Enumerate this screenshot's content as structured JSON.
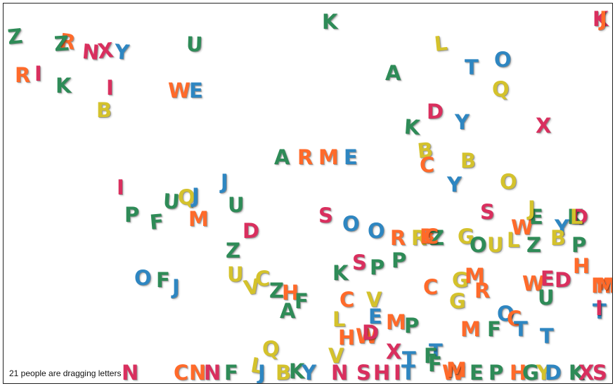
{
  "status_text": "21 people are dragging letters",
  "palette": {
    "G": "#2e8b57",
    "R": "#ff6a2a",
    "P": "#d92f5e",
    "B": "#2e86c1",
    "Y": "#d4c22c"
  },
  "letters": [
    [
      "Z",
      "G"
    ],
    [
      "R",
      "R"
    ],
    [
      "Z",
      "G"
    ],
    [
      "N",
      "P"
    ],
    [
      "X",
      "P"
    ],
    [
      "Y",
      "B"
    ],
    [
      "U",
      "G"
    ],
    [
      "K",
      "G"
    ],
    [
      "K",
      "P"
    ],
    [
      "J",
      "R"
    ],
    [
      "R",
      "R"
    ],
    [
      "I",
      "P"
    ],
    [
      "K",
      "G"
    ],
    [
      "I",
      "P"
    ],
    [
      "W",
      "R"
    ],
    [
      "E",
      "B"
    ],
    [
      "B",
      "Y"
    ],
    [
      "L",
      "Y"
    ],
    [
      "T",
      "B"
    ],
    [
      "O",
      "B"
    ],
    [
      "A",
      "G"
    ],
    [
      "Q",
      "Y"
    ],
    [
      "D",
      "P"
    ],
    [
      "K",
      "G"
    ],
    [
      "Y",
      "B"
    ],
    [
      "X",
      "P"
    ],
    [
      "A",
      "G"
    ],
    [
      "R",
      "R"
    ],
    [
      "M",
      "R"
    ],
    [
      "E",
      "B"
    ],
    [
      "B",
      "Y"
    ],
    [
      "C",
      "R"
    ],
    [
      "B",
      "Y"
    ],
    [
      "Y",
      "B"
    ],
    [
      "J",
      "B"
    ],
    [
      "O",
      "Y"
    ],
    [
      "I",
      "P"
    ],
    [
      "U",
      "G"
    ],
    [
      "Q",
      "Y"
    ],
    [
      "J",
      "B"
    ],
    [
      "U",
      "G"
    ],
    [
      "P",
      "G"
    ],
    [
      "F",
      "G"
    ],
    [
      "M",
      "R"
    ],
    [
      "S",
      "P"
    ],
    [
      "O",
      "B"
    ],
    [
      "O",
      "B"
    ],
    [
      "R",
      "R"
    ],
    [
      "R",
      "Y"
    ],
    [
      "B",
      "R"
    ],
    [
      "Z",
      "G"
    ],
    [
      "G",
      "Y"
    ],
    [
      "S",
      "P"
    ],
    [
      "W",
      "R"
    ],
    [
      "D",
      "P"
    ],
    [
      "Z",
      "G"
    ],
    [
      "O",
      "G"
    ],
    [
      "U",
      "Y"
    ],
    [
      "L",
      "Y"
    ],
    [
      "Z",
      "G"
    ],
    [
      "O",
      "B"
    ],
    [
      "F",
      "G"
    ],
    [
      "J",
      "B"
    ],
    [
      "U",
      "Y"
    ],
    [
      "V",
      "Y"
    ],
    [
      "C",
      "Y"
    ],
    [
      "Z",
      "G"
    ],
    [
      "H",
      "R"
    ],
    [
      "A",
      "G"
    ],
    [
      "F",
      "G"
    ],
    [
      "K",
      "G"
    ],
    [
      "S",
      "P"
    ],
    [
      "P",
      "G"
    ],
    [
      "P",
      "G"
    ],
    [
      "C",
      "R"
    ],
    [
      "G",
      "Y"
    ],
    [
      "M",
      "R"
    ],
    [
      "R",
      "R"
    ],
    [
      "W",
      "R"
    ],
    [
      "E",
      "P"
    ],
    [
      "D",
      "P"
    ],
    [
      "U",
      "G"
    ],
    [
      "H",
      "R"
    ],
    [
      "M",
      "R"
    ],
    [
      "T",
      "B"
    ],
    [
      "C",
      "R"
    ],
    [
      "V",
      "Y"
    ],
    [
      "E",
      "B"
    ],
    [
      "M",
      "R"
    ],
    [
      "P",
      "G"
    ],
    [
      "L",
      "Y"
    ],
    [
      "H",
      "R"
    ],
    [
      "W",
      "R"
    ],
    [
      "D",
      "P"
    ],
    [
      "X",
      "P"
    ],
    [
      "G",
      "Y"
    ],
    [
      "M",
      "R"
    ],
    [
      "F",
      "G"
    ],
    [
      "O",
      "B"
    ],
    [
      "C",
      "R"
    ],
    [
      "T",
      "B"
    ],
    [
      "T",
      "B"
    ],
    [
      "T",
      "B"
    ],
    [
      "Q",
      "Y"
    ],
    [
      "V",
      "Y"
    ],
    [
      "T",
      "B"
    ],
    [
      "N",
      "P"
    ],
    [
      "C",
      "R"
    ],
    [
      "N",
      "R"
    ],
    [
      "N",
      "P"
    ],
    [
      "F",
      "G"
    ],
    [
      "L",
      "Y"
    ],
    [
      "J",
      "B"
    ],
    [
      "B",
      "Y"
    ],
    [
      "K",
      "G"
    ],
    [
      "Y",
      "B"
    ],
    [
      "N",
      "P"
    ],
    [
      "S",
      "P"
    ],
    [
      "H",
      "P"
    ],
    [
      "I",
      "P"
    ],
    [
      "T",
      "B"
    ],
    [
      "W",
      "R"
    ],
    [
      "E",
      "G"
    ],
    [
      "P",
      "G"
    ],
    [
      "H",
      "R"
    ],
    [
      "G",
      "G"
    ],
    [
      "Y",
      "Y"
    ],
    [
      "D",
      "B"
    ],
    [
      "K",
      "G"
    ],
    [
      "X",
      "P"
    ],
    [
      "S",
      "P"
    ],
    [
      "M",
      "R"
    ],
    [
      "P",
      "G"
    ],
    [
      "K",
      "G"
    ],
    [
      "D",
      "P"
    ],
    [
      "L",
      "Y"
    ],
    [
      "Y",
      "B"
    ],
    [
      "E",
      "G"
    ],
    [
      "J",
      "Y"
    ],
    [
      "B",
      "Y"
    ],
    [
      "C",
      "R"
    ],
    [
      "F",
      "G"
    ],
    [
      "F",
      "G"
    ],
    [
      "M",
      "R"
    ],
    [
      "I",
      "P"
    ]
  ]
}
